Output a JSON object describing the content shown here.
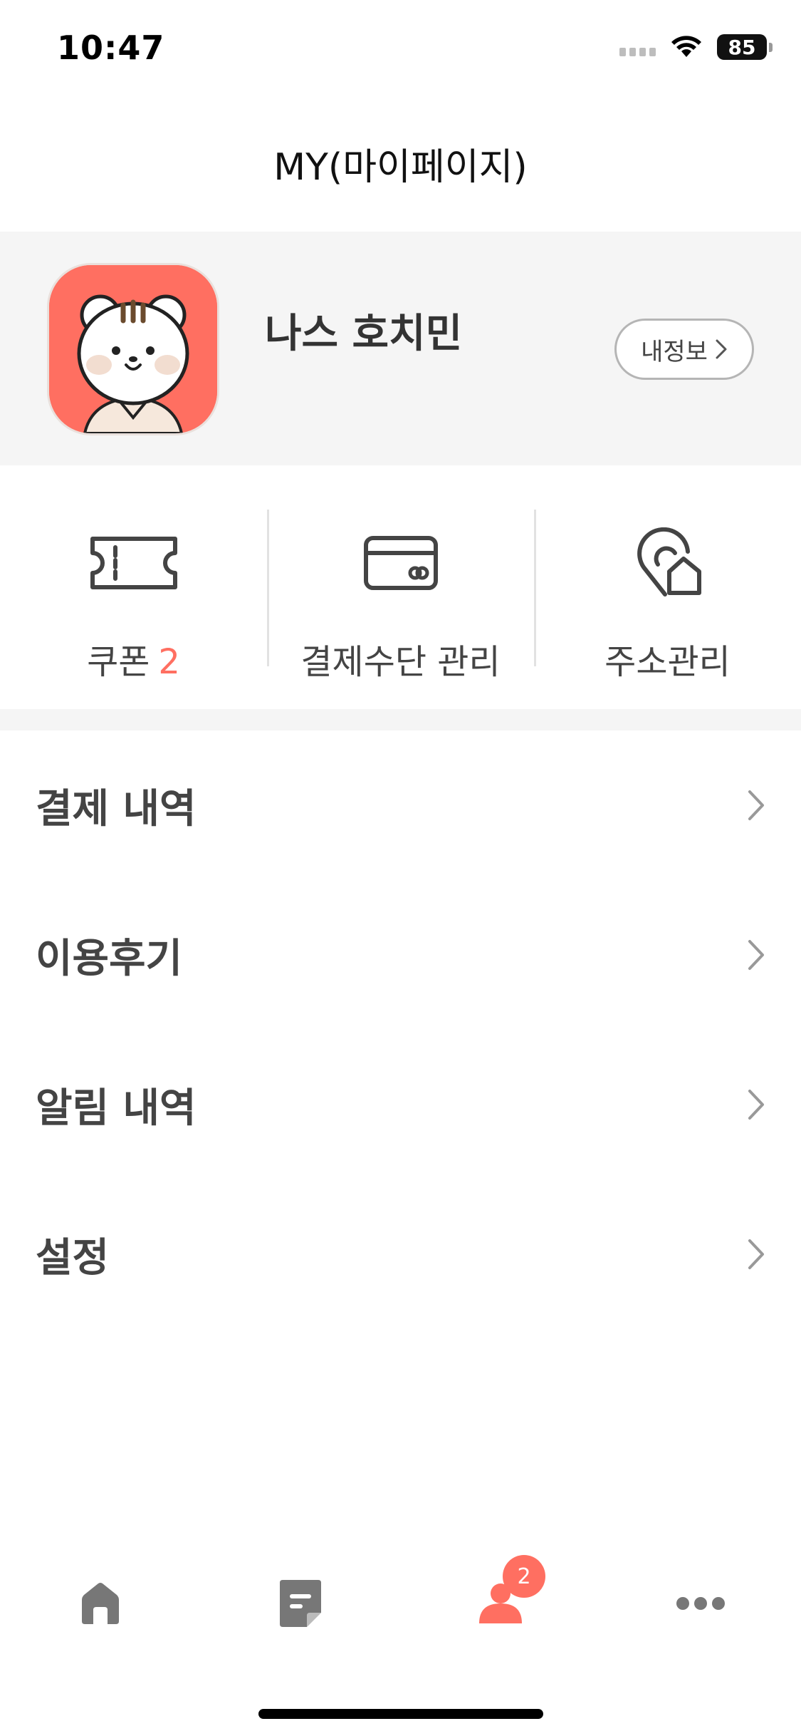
{
  "status_bar": {
    "time": "10:47",
    "battery": "85"
  },
  "header": {
    "title": "MY(마이페이지)"
  },
  "profile": {
    "name": "나스 호치민",
    "my_info_label": "내정보"
  },
  "quick_menu": [
    {
      "label": "쿠폰",
      "count": "2",
      "icon": "ticket-icon"
    },
    {
      "label": "결제수단 관리",
      "icon": "credit-card-icon"
    },
    {
      "label": "주소관리",
      "icon": "location-home-icon"
    }
  ],
  "menu": [
    {
      "label": "결제 내역"
    },
    {
      "label": "이용후기"
    },
    {
      "label": "알림 내역"
    },
    {
      "label": "설정"
    }
  ],
  "tabbar": {
    "items": [
      {
        "icon": "home-icon"
      },
      {
        "icon": "note-icon"
      },
      {
        "icon": "person-icon"
      },
      {
        "icon": "more-icon"
      }
    ],
    "badge": "2"
  },
  "colors": {
    "accent": "#ff6f61",
    "icon_gray": "#777777",
    "section_bg": "#f5f5f5"
  }
}
